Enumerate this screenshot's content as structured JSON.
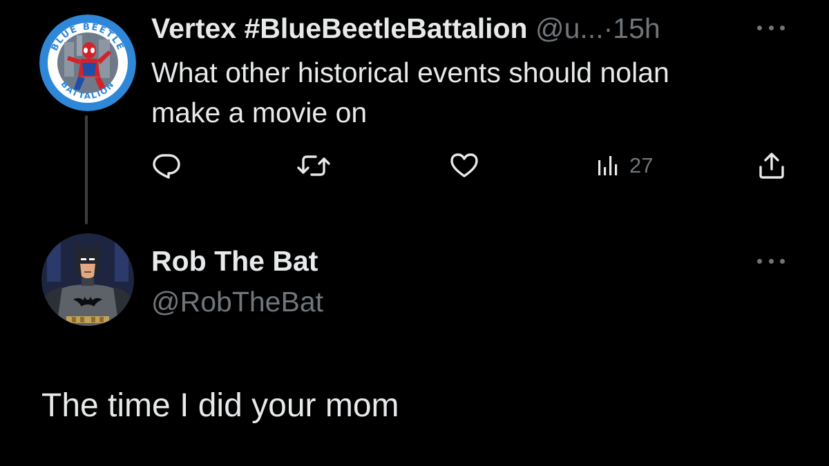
{
  "parent_tweet": {
    "display_name": "Vertex #BlueBeetleBattalion",
    "handle": "@u...",
    "separator": "·",
    "time": "15h",
    "text_line1": "What other historical events should nolan",
    "text_line2": "make a movie on",
    "views_count": "27",
    "avatar": {
      "icon": "blue-beetle-battalion-avatar",
      "ring_text_top": "BLUE BEETLE",
      "ring_text_bottom": "BATTALION"
    }
  },
  "reply_tweet": {
    "display_name": "Rob The Bat",
    "handle": "@RobTheBat",
    "text": "The time I did your mom",
    "avatar": {
      "icon": "batman-avatar"
    }
  },
  "icons": {
    "reply": "reply-icon",
    "retweet": "retweet-icon",
    "like": "heart-icon",
    "views": "views-icon",
    "share": "share-icon",
    "more": "more-icon"
  },
  "colors": {
    "background": "#000000",
    "primary_text": "#e7e9ea",
    "secondary_text": "#71767b",
    "thread_line": "#3a3e42",
    "avatar_ring": "#2f87d8"
  }
}
